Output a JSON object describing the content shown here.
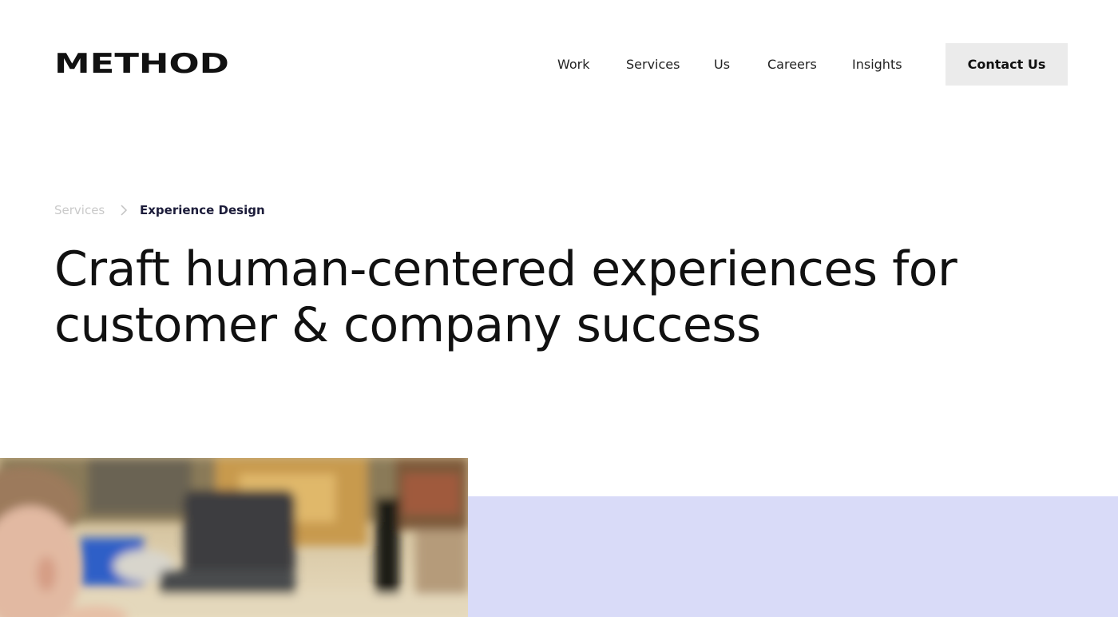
{
  "brand": {
    "logo_text": "METHOD"
  },
  "nav": {
    "items": [
      {
        "label": "Work"
      },
      {
        "label": "Services"
      },
      {
        "label": "Us"
      },
      {
        "label": "Careers"
      },
      {
        "label": "Insights"
      }
    ],
    "cta_label": "Contact Us"
  },
  "breadcrumb": {
    "parent": "Services",
    "separator_icon": "chevron-right-icon",
    "current": "Experience Design"
  },
  "hero": {
    "headline": "Craft human-centered experiences for customer & company success",
    "image_icon": "office-photo",
    "panel_color": "#d9dbf8"
  },
  "colors": {
    "text": "#111111",
    "muted": "#c9c9c9",
    "button_bg": "#ebebeb",
    "accent_lavender": "#d9dbf8"
  }
}
